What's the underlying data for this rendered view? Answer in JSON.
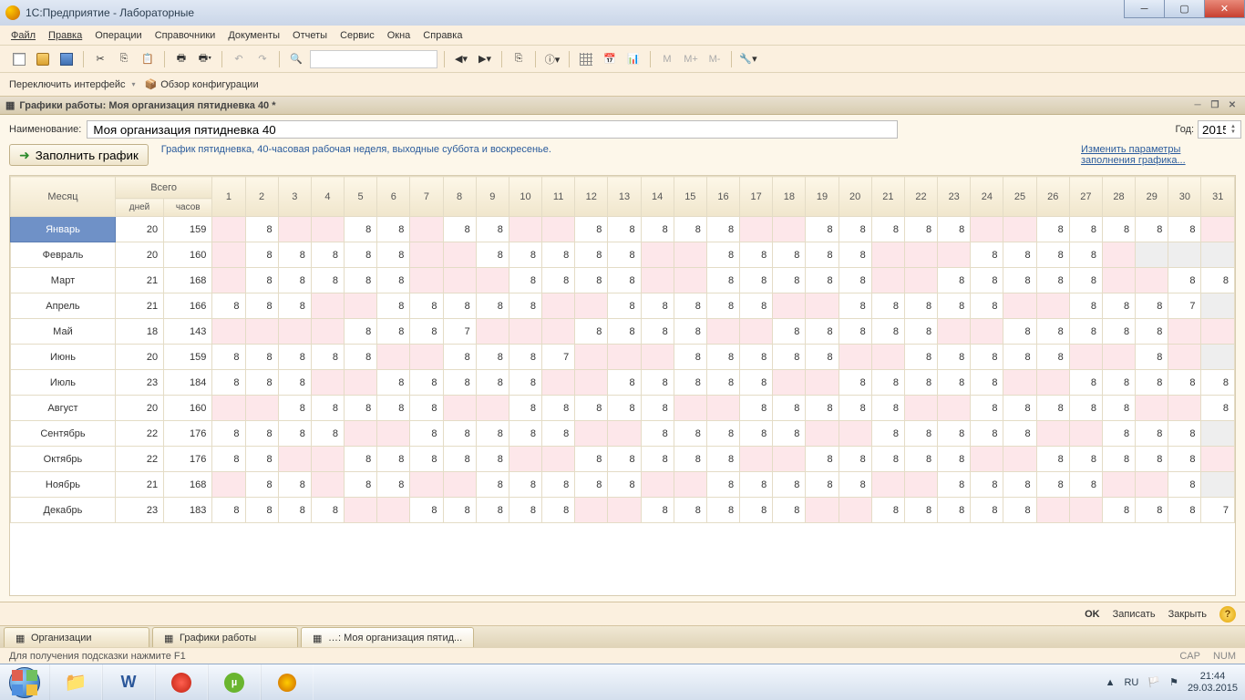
{
  "window": {
    "title": "1С:Предприятие - Лабораторные"
  },
  "menu": {
    "file": "Файл",
    "edit": "Правка",
    "operations": "Операции",
    "refs": "Справочники",
    "docs": "Документы",
    "reports": "Отчеты",
    "service": "Сервис",
    "windows": "Окна",
    "help": "Справка"
  },
  "toolbar2": {
    "switch_iface": "Переключить интерфейс",
    "config_overview": "Обзор конфигурации"
  },
  "doc": {
    "header": "Графики работы: Моя организация пятидневка 40 *",
    "name_label": "Наименование:",
    "name_value": "Моя организация пятидневка 40",
    "year_label": "Год:",
    "year_value": "2015",
    "fill_btn": "Заполнить график",
    "description": "График пятидневка, 40-часовая рабочая неделя, выходные суббота и воскресенье.",
    "change_params": "Изменить параметры заполнения графика..."
  },
  "table": {
    "hdr_month": "Месяц",
    "hdr_total": "Всего",
    "hdr_days": "дней",
    "hdr_hours": "часов",
    "months": [
      {
        "name": "Январь",
        "days": 20,
        "hours": 159,
        "d": [
          null,
          8,
          null,
          null,
          8,
          8,
          null,
          8,
          8,
          null,
          null,
          8,
          8,
          8,
          8,
          8,
          null,
          null,
          8,
          8,
          8,
          8,
          8,
          null,
          null,
          8,
          8,
          8,
          8,
          8,
          null
        ]
      },
      {
        "name": "Февраль",
        "days": 20,
        "hours": 160,
        "d": [
          null,
          8,
          8,
          8,
          8,
          8,
          null,
          null,
          8,
          8,
          8,
          8,
          8,
          null,
          null,
          8,
          8,
          8,
          8,
          8,
          null,
          null,
          null,
          8,
          8,
          8,
          8,
          null,
          null,
          null,
          null
        ],
        "gray_after": 28
      },
      {
        "name": "Март",
        "days": 21,
        "hours": 168,
        "d": [
          null,
          8,
          8,
          8,
          8,
          8,
          null,
          null,
          null,
          8,
          8,
          8,
          8,
          null,
          null,
          8,
          8,
          8,
          8,
          8,
          null,
          null,
          8,
          8,
          8,
          8,
          8,
          null,
          null,
          8,
          8
        ]
      },
      {
        "name": "Апрель",
        "days": 21,
        "hours": 166,
        "d": [
          8,
          8,
          8,
          null,
          null,
          8,
          8,
          8,
          8,
          8,
          null,
          null,
          8,
          8,
          8,
          8,
          8,
          null,
          null,
          8,
          8,
          8,
          8,
          8,
          null,
          null,
          8,
          8,
          8,
          7,
          null
        ],
        "gray_after": 30
      },
      {
        "name": "Май",
        "days": 18,
        "hours": 143,
        "d": [
          null,
          null,
          null,
          null,
          8,
          8,
          8,
          7,
          null,
          null,
          null,
          8,
          8,
          8,
          8,
          null,
          null,
          8,
          8,
          8,
          8,
          8,
          null,
          null,
          8,
          8,
          8,
          8,
          8,
          null,
          null
        ]
      },
      {
        "name": "Июнь",
        "days": 20,
        "hours": 159,
        "d": [
          8,
          8,
          8,
          8,
          8,
          null,
          null,
          8,
          8,
          8,
          7,
          null,
          null,
          null,
          8,
          8,
          8,
          8,
          8,
          null,
          null,
          8,
          8,
          8,
          8,
          8,
          null,
          null,
          8,
          null,
          null
        ],
        "gray_after": 30
      },
      {
        "name": "Июль",
        "days": 23,
        "hours": 184,
        "d": [
          8,
          8,
          8,
          null,
          null,
          8,
          8,
          8,
          8,
          8,
          null,
          null,
          8,
          8,
          8,
          8,
          8,
          null,
          null,
          8,
          8,
          8,
          8,
          8,
          null,
          null,
          8,
          8,
          8,
          8,
          8
        ]
      },
      {
        "name": "Август",
        "days": 20,
        "hours": 160,
        "d": [
          null,
          null,
          8,
          8,
          8,
          8,
          8,
          null,
          null,
          8,
          8,
          8,
          8,
          8,
          null,
          null,
          8,
          8,
          8,
          8,
          8,
          null,
          null,
          8,
          8,
          8,
          8,
          8,
          null,
          null,
          8
        ]
      },
      {
        "name": "Сентябрь",
        "days": 22,
        "hours": 176,
        "d": [
          8,
          8,
          8,
          8,
          null,
          null,
          8,
          8,
          8,
          8,
          8,
          null,
          null,
          8,
          8,
          8,
          8,
          8,
          null,
          null,
          8,
          8,
          8,
          8,
          8,
          null,
          null,
          8,
          8,
          8,
          null
        ],
        "gray_after": 30
      },
      {
        "name": "Октябрь",
        "days": 22,
        "hours": 176,
        "d": [
          8,
          8,
          null,
          null,
          8,
          8,
          8,
          8,
          8,
          null,
          null,
          8,
          8,
          8,
          8,
          8,
          null,
          null,
          8,
          8,
          8,
          8,
          8,
          null,
          null,
          8,
          8,
          8,
          8,
          8,
          null
        ]
      },
      {
        "name": "Ноябрь",
        "days": 21,
        "hours": 168,
        "d": [
          null,
          8,
          8,
          null,
          8,
          8,
          null,
          null,
          8,
          8,
          8,
          8,
          8,
          null,
          null,
          8,
          8,
          8,
          8,
          8,
          null,
          null,
          8,
          8,
          8,
          8,
          8,
          null,
          null,
          8,
          null
        ],
        "gray_after": 30
      },
      {
        "name": "Декабрь",
        "days": 23,
        "hours": 183,
        "d": [
          8,
          8,
          8,
          8,
          null,
          null,
          8,
          8,
          8,
          8,
          8,
          null,
          null,
          8,
          8,
          8,
          8,
          8,
          null,
          null,
          8,
          8,
          8,
          8,
          8,
          null,
          null,
          8,
          8,
          8,
          7
        ]
      }
    ]
  },
  "bottom": {
    "ok": "OK",
    "save": "Записать",
    "close": "Закрыть"
  },
  "tabs": {
    "t1": "Организации",
    "t2": "Графики работы",
    "t3": "…: Моя организация пятид..."
  },
  "status": {
    "hint": "Для получения подсказки нажмите F1",
    "cap": "CAP",
    "num": "NUM"
  },
  "tray": {
    "lang": "RU",
    "time": "21:44",
    "date": "29.03.2015"
  }
}
